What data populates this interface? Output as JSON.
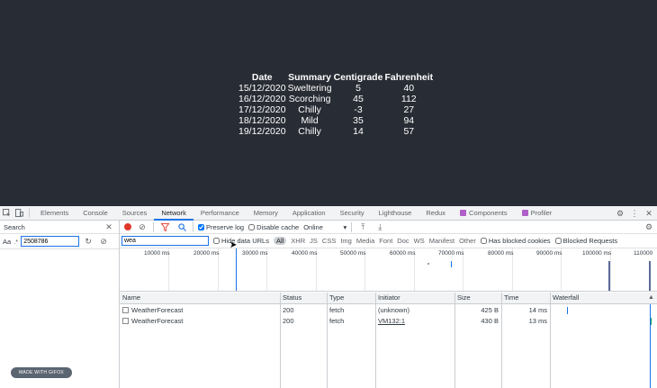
{
  "weather": {
    "headers": [
      "Date",
      "Summary",
      "Centigrade",
      "Fahrenheit"
    ],
    "rows": [
      [
        "15/12/2020",
        "Sweltering",
        "5",
        "40"
      ],
      [
        "16/12/2020",
        "Scorching",
        "45",
        "112"
      ],
      [
        "17/12/2020",
        "Chilly",
        "-3",
        "27"
      ],
      [
        "18/12/2020",
        "Mild",
        "35",
        "94"
      ],
      [
        "19/12/2020",
        "Chilly",
        "14",
        "57"
      ]
    ]
  },
  "devtools": {
    "tabs": [
      "Elements",
      "Console",
      "Sources",
      "Network",
      "Performance",
      "Memory",
      "Application",
      "Security",
      "Lighthouse",
      "Redux",
      "Components",
      "Profiler"
    ],
    "active_tab": "Network",
    "search": {
      "title": "Search",
      "aa_label": "Aa",
      "regex_label": ".*",
      "query": "2508786",
      "gif_badge": "MADE WITH GIFOX"
    },
    "toolbar": {
      "preserve_log": "Preserve log",
      "disable_cache": "Disable cache",
      "throttle": "Online"
    },
    "filter": {
      "value": "wea",
      "hide_data_urls": "Hide data URLs",
      "types": [
        "All",
        "XHR",
        "JS",
        "CSS",
        "Img",
        "Media",
        "Font",
        "Doc",
        "WS",
        "Manifest",
        "Other"
      ],
      "blocked_cookies": "Has blocked cookies",
      "blocked_requests": "Blocked Requests"
    },
    "timeline_ticks": [
      "10000 ms",
      "20000 ms",
      "30000 ms",
      "40000 ms",
      "50000 ms",
      "60000 ms",
      "70000 ms",
      "80000 ms",
      "90000 ms",
      "100000 ms",
      "110000"
    ],
    "columns": [
      "Name",
      "Status",
      "Type",
      "Initiator",
      "Size",
      "Time",
      "Waterfall"
    ],
    "requests": [
      {
        "name": "WeatherForecast",
        "status": "200",
        "type": "fetch",
        "initiator": "(unknown)",
        "size": "425 B",
        "time": "14 ms"
      },
      {
        "name": "WeatherForecast",
        "status": "200",
        "type": "fetch",
        "initiator": "VM132:1",
        "size": "430 B",
        "time": "13 ms"
      }
    ]
  },
  "colors": {
    "page_bg": "#282c34",
    "accent": "#1a73e8",
    "record": "#e0382a"
  }
}
